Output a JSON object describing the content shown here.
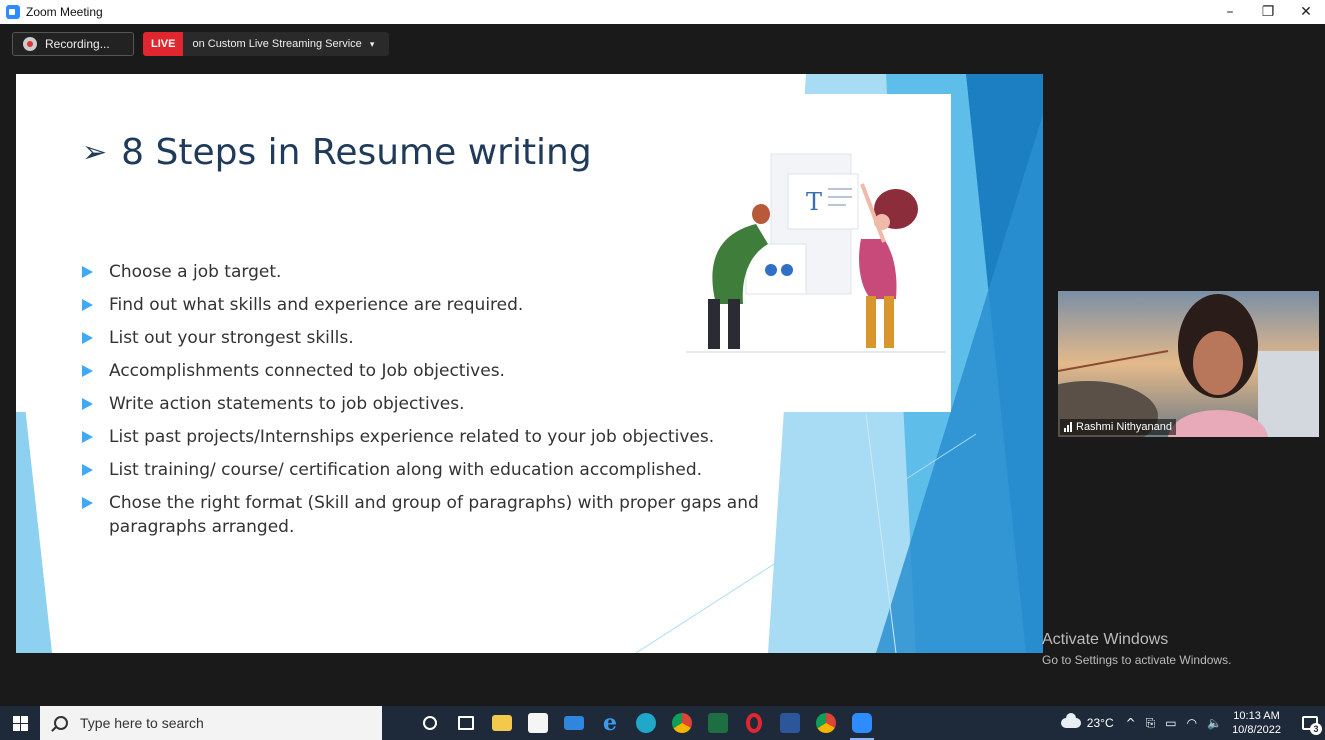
{
  "window": {
    "title": "Zoom Meeting",
    "controls": {
      "minimize": "–",
      "restore": "❐",
      "close": "✕"
    }
  },
  "meeting": {
    "recording_label": "Recording...",
    "live_badge": "LIVE",
    "live_text": "on Custom Live Streaming Service",
    "live_caret": "▾"
  },
  "slide": {
    "title_arrow": "➢",
    "title": "8 Steps in Resume writing",
    "bullets": [
      "Choose a job target.",
      "Find out what skills and experience are required.",
      "List out your strongest skills.",
      "Accomplishments connected to Job objectives.",
      "Write action statements to job objectives.",
      "List past projects/Internships experience related to your job objectives.",
      "List training/ course/ certification along with education accomplished.",
      "Chose the right format (Skill and group of paragraphs) with proper gaps and paragraphs arranged."
    ],
    "illustration_letter": "T",
    "colors": {
      "title": "#1f3a5a",
      "bullet_marker": "#3fa9f5",
      "accent_light": "#a8dcf5",
      "accent_dark": "#1b7fc1"
    }
  },
  "participant": {
    "name": "Rashmi Nithyanand"
  },
  "watermark": {
    "line1": "Activate Windows",
    "line2": "Go to Settings to activate Windows."
  },
  "taskbar": {
    "search_placeholder": "Type here to search",
    "apps": [
      "cortana-icon",
      "task-view-icon",
      "file-explorer-icon",
      "store-icon",
      "mail-icon",
      "internet-explorer-icon",
      "edge-icon",
      "chrome-icon",
      "excel-icon",
      "opera-icon",
      "word-icon",
      "chrome-profile-icon",
      "zoom-icon"
    ],
    "weather": "23°C",
    "time": "10:13 AM",
    "date": "10/8/2022",
    "notification_count": "3"
  }
}
